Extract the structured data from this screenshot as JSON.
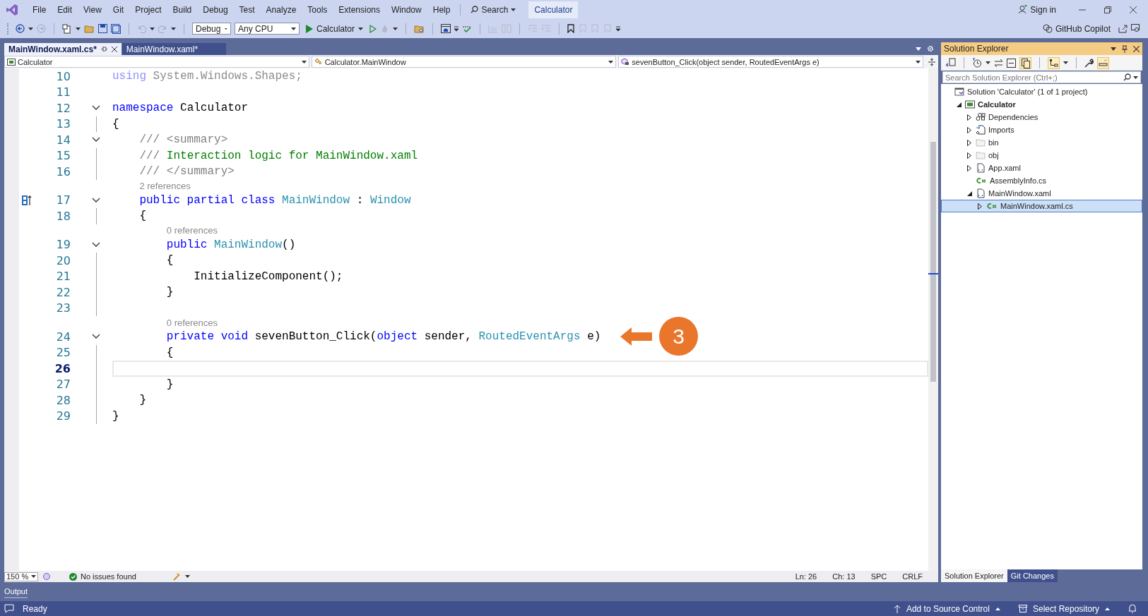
{
  "menu": {
    "items": [
      "File",
      "Edit",
      "View",
      "Git",
      "Project",
      "Build",
      "Debug",
      "Test",
      "Analyze",
      "Tools",
      "Extensions",
      "Window",
      "Help"
    ],
    "search": "Search",
    "solution_name": "Calculator",
    "sign_in": "Sign in"
  },
  "toolbar": {
    "configuration": "Debug",
    "platform": "Any CPU",
    "start_target": "Calculator",
    "copilot": "GitHub Copilot"
  },
  "tabs": [
    {
      "label": "MainWindow.xaml.cs*",
      "selected": true
    },
    {
      "label": "MainWindow.xaml*",
      "selected": false
    }
  ],
  "nav_bar": {
    "project": "Calculator",
    "type": "Calculator.MainWindow",
    "member": "sevenButton_Click(object sender, RoutedEventArgs e)"
  },
  "editor": {
    "lines": [
      {
        "kind": "code",
        "number": "10",
        "fold": false,
        "tokens": [
          {
            "text": "using",
            "kind": "faded_keyword"
          },
          {
            "text": " System.Windows.Shapes;",
            "kind": "faded"
          }
        ]
      },
      {
        "kind": "code",
        "number": "11",
        "fold": false
      },
      {
        "kind": "code",
        "number": "12",
        "fold": true,
        "tokens": [
          {
            "text": "namespace",
            "kind": "keyword"
          },
          {
            "text": " Calculator",
            "kind": "plain"
          }
        ]
      },
      {
        "kind": "code",
        "number": "13",
        "fold": false,
        "tokens": [
          {
            "text": "{",
            "kind": "plain"
          }
        ]
      },
      {
        "kind": "code",
        "number": "14",
        "fold": true,
        "tokens": [
          {
            "text": "    /// <summary>",
            "kind": "doc"
          }
        ]
      },
      {
        "kind": "code",
        "number": "15",
        "fold": false,
        "tokens": [
          {
            "text": "    ///",
            "kind": "doc"
          },
          {
            "text": " Interaction logic for MainWindow.xaml",
            "kind": "comment"
          }
        ]
      },
      {
        "kind": "code",
        "number": "16",
        "fold": false,
        "tokens": [
          {
            "text": "    /// </summary>",
            "kind": "doc"
          }
        ]
      },
      {
        "kind": "lens",
        "text": "2 references"
      },
      {
        "kind": "code",
        "number": "17",
        "fold": true,
        "marker": true,
        "tokens": [
          {
            "text": "    public partial class ",
            "kind": "keyword"
          },
          {
            "text": "MainWindow",
            "kind": "type"
          },
          {
            "text": " : ",
            "kind": "plain"
          },
          {
            "text": "Window",
            "kind": "type"
          }
        ]
      },
      {
        "kind": "code",
        "number": "18",
        "fold": false,
        "tokens": [
          {
            "text": "    {",
            "kind": "plain"
          }
        ]
      },
      {
        "kind": "lens",
        "text": "0 references"
      },
      {
        "kind": "code",
        "number": "19",
        "fold": true,
        "tokens": [
          {
            "text": "        public ",
            "kind": "keyword"
          },
          {
            "text": "MainWindow",
            "kind": "type"
          },
          {
            "text": "()",
            "kind": "plain"
          }
        ]
      },
      {
        "kind": "code",
        "number": "20",
        "fold": false,
        "tokens": [
          {
            "text": "        {",
            "kind": "plain"
          }
        ]
      },
      {
        "kind": "code",
        "number": "21",
        "fold": false,
        "tokens": [
          {
            "text": "            InitializeComponent();",
            "kind": "plain"
          }
        ]
      },
      {
        "kind": "code",
        "number": "22",
        "fold": false,
        "tokens": [
          {
            "text": "        }",
            "kind": "plain"
          }
        ]
      },
      {
        "kind": "code",
        "number": "23",
        "fold": false
      },
      {
        "kind": "lens",
        "text": "0 references"
      },
      {
        "kind": "code",
        "number": "24",
        "fold": true,
        "callout": "3",
        "tokens": [
          {
            "text": "        private void",
            "kind": "keyword"
          },
          {
            "text": " sevenButton_Click(",
            "kind": "plain"
          },
          {
            "text": "object",
            "kind": "keyword"
          },
          {
            "text": " sender, ",
            "kind": "plain"
          },
          {
            "text": "RoutedEventArgs",
            "kind": "type"
          },
          {
            "text": " e)",
            "kind": "plain"
          }
        ]
      },
      {
        "kind": "code",
        "number": "25",
        "fold": false,
        "tokens": [
          {
            "text": "        {",
            "kind": "plain"
          }
        ]
      },
      {
        "kind": "code",
        "number": "26",
        "fold": false,
        "current": true
      },
      {
        "kind": "code",
        "number": "27",
        "fold": false,
        "tokens": [
          {
            "text": "        }",
            "kind": "plain"
          }
        ]
      },
      {
        "kind": "code",
        "number": "28",
        "fold": false,
        "tokens": [
          {
            "text": "    }",
            "kind": "plain"
          }
        ]
      },
      {
        "kind": "code",
        "number": "29",
        "fold": false,
        "tokens": [
          {
            "text": "}",
            "kind": "plain"
          }
        ]
      }
    ]
  },
  "editor_status": {
    "zoom": "150 %",
    "issues": "No issues found",
    "line": "Ln: 26",
    "column": "Ch: 13",
    "whitespace": "SPC",
    "line_endings": "CRLF"
  },
  "solution_explorer": {
    "title": "Solution Explorer",
    "search": {
      "placeholder": "Search Solution Explorer (Ctrl+;)"
    },
    "tree": [
      {
        "label": "Solution 'Calculator' (1 of 1 project)",
        "kind": "solution",
        "selected": false,
        "children": [
          {
            "label": "Calculator",
            "kind": "project",
            "expanded": true,
            "selected": false,
            "children": [
              {
                "label": "Dependencies",
                "kind": "dependencies",
                "expanded": false,
                "selected": false
              },
              {
                "label": "Imports",
                "kind": "imports",
                "expanded": false,
                "selected": false
              },
              {
                "label": "bin",
                "kind": "folder",
                "expanded": false,
                "selected": false
              },
              {
                "label": "obj",
                "kind": "folder",
                "expanded": false,
                "selected": false
              },
              {
                "label": "App.xaml",
                "kind": "xaml",
                "expanded": false,
                "selected": false
              },
              {
                "label": "AssemblyInfo.cs",
                "kind": "csharp",
                "selected": false
              },
              {
                "label": "MainWindow.xaml",
                "kind": "xaml",
                "expanded": true,
                "selected": false,
                "children": [
                  {
                    "label": "MainWindow.xaml.cs",
                    "kind": "csharp",
                    "expanded": false,
                    "selected": true
                  }
                ]
              }
            ]
          }
        ]
      }
    ],
    "tabs": [
      {
        "label": "Solution Explorer",
        "selected": true
      },
      {
        "label": "Git Changes",
        "selected": false
      }
    ]
  },
  "bottom_panel": {
    "tab": "Output"
  },
  "status_bar": {
    "status": "Ready",
    "source_control": "Add to Source Control",
    "repository": "Select Repository"
  }
}
